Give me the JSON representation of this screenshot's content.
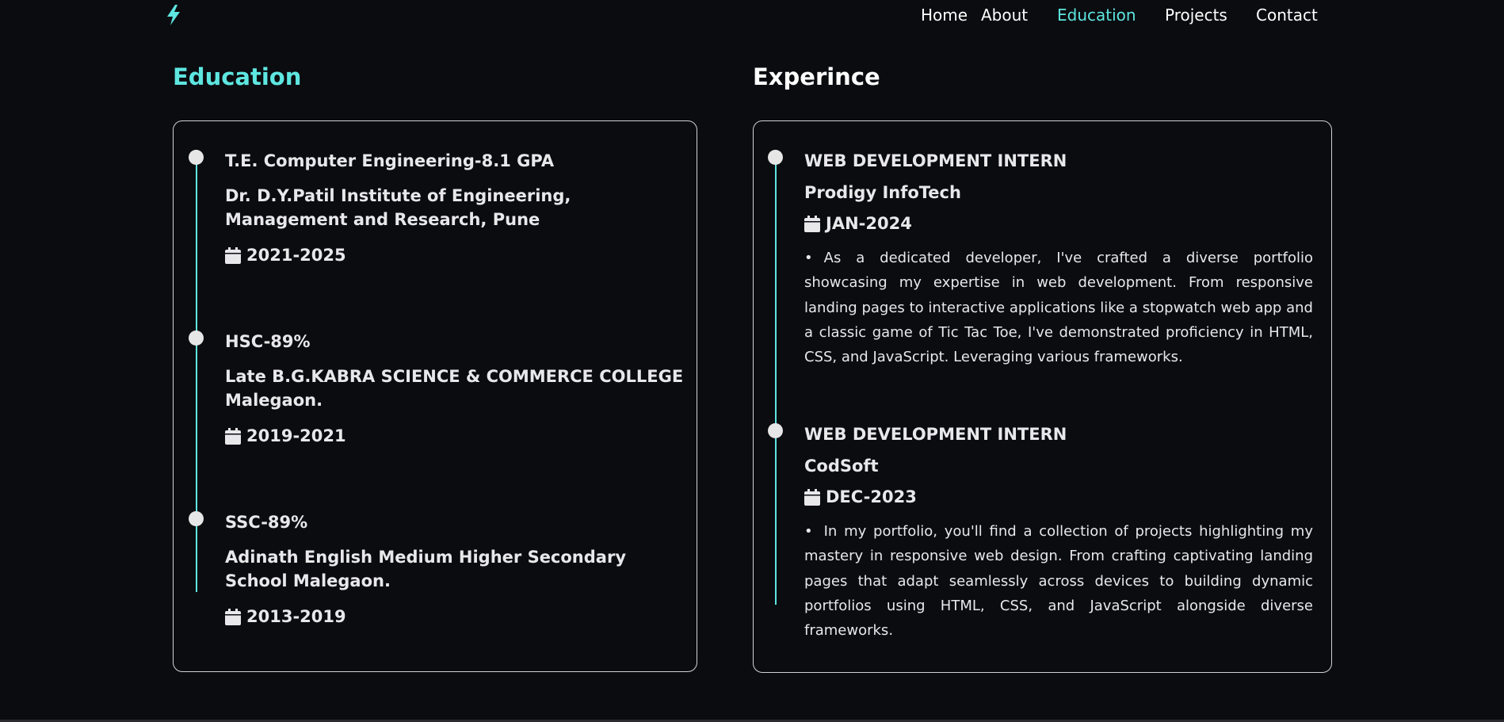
{
  "nav": {
    "links": [
      {
        "label": "Home"
      },
      {
        "label": "About"
      },
      {
        "label": "Education",
        "active": true
      },
      {
        "label": "Projects"
      },
      {
        "label": "Contact"
      }
    ],
    "logo_icon": "lightning-bolt-icon",
    "accent_color": "#5ee6e0"
  },
  "education": {
    "title": "Education",
    "entries": [
      {
        "title": "T.E. Computer Engineering-8.1 GPA",
        "institution": "Dr. D.Y.Patil Institute of Engineering, Management and Research, Pune",
        "years": "2021-2025"
      },
      {
        "title": "HSC-89%",
        "institution": "Late B.G.KABRA SCIENCE & COMMERCE COLLEGE Malegaon.",
        "years": "2019-2021"
      },
      {
        "title": "SSC-89%",
        "institution": "Adinath English Medium Higher Secondary School Malegaon.",
        "years": "2013-2019"
      }
    ]
  },
  "experience": {
    "title": "Experince",
    "entries": [
      {
        "role": "WEB DEVELOPMENT INTERN",
        "company": "Prodigy InfoTech",
        "date": "JAN-2024",
        "bullet": "•",
        "description": "As a dedicated developer, I've crafted a diverse portfolio showcasing my expertise in web development. From responsive landing pages to interactive applications like a stopwatch web app and a classic game of Tic Tac Toe, I've demonstrated proficiency in HTML, CSS, and JavaScript. Leveraging various frameworks."
      },
      {
        "role": "WEB DEVELOPMENT INTERN",
        "company": "CodSoft",
        "date": "DEC-2023",
        "bullet": "•",
        "description": "In my portfolio, you'll find a collection of projects highlighting my mastery in responsive web design. From crafting captivating landing pages that adapt seamlessly across devices to building dynamic portfolios using HTML, CSS, and JavaScript alongside diverse frameworks."
      }
    ]
  }
}
